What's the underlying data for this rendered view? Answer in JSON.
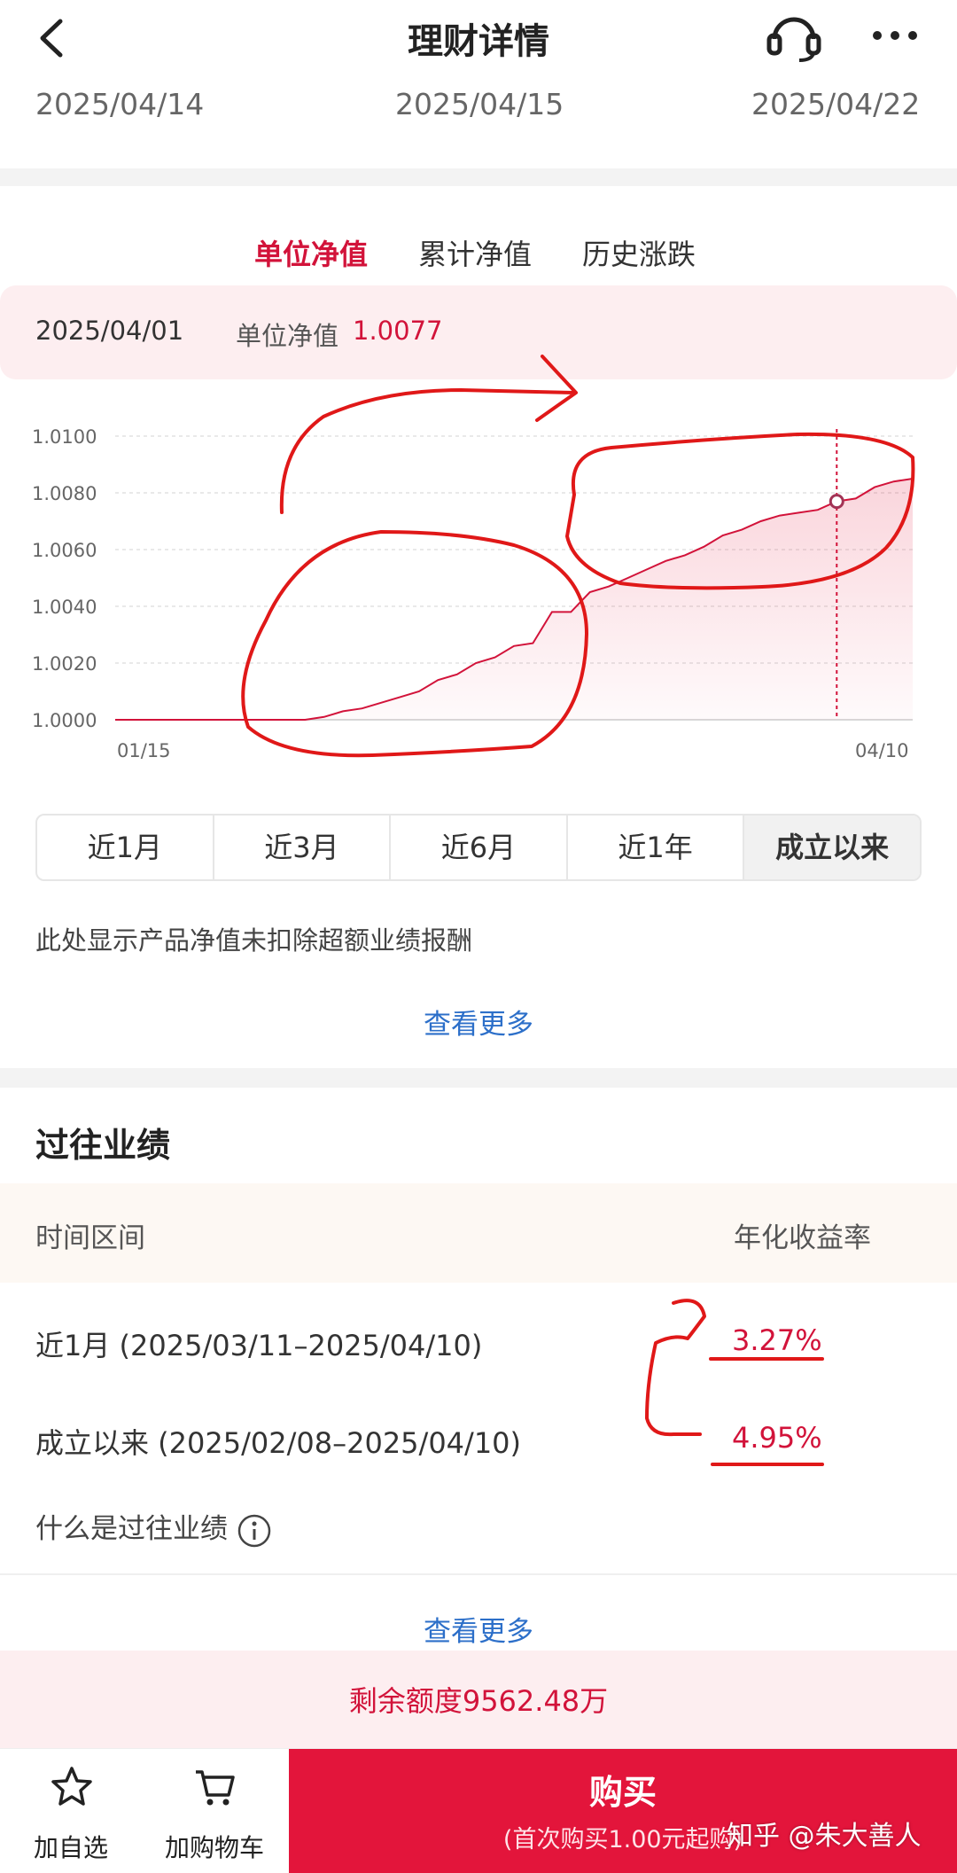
{
  "header": {
    "title": "理财详情",
    "back_icon": "chevron-left-icon",
    "service_icon": "headset-icon",
    "more_icon": "more-dots-icon"
  },
  "dates": [
    "2025/04/14",
    "2025/04/15",
    "2025/04/22"
  ],
  "tabs": [
    {
      "label": "单位净值",
      "active": true
    },
    {
      "label": "累计净值",
      "active": false
    },
    {
      "label": "历史涨跌",
      "active": false
    }
  ],
  "info_strip": {
    "date": "2025/04/01",
    "label": "单位净值",
    "value": "1.0077"
  },
  "chart_data": {
    "type": "area",
    "x_labels": [
      "01/15",
      "04/10"
    ],
    "y_ticks": [
      "1.0100",
      "1.0080",
      "1.0060",
      "1.0040",
      "1.0020",
      "1.0000"
    ],
    "ylim": [
      1.0,
      1.01
    ],
    "values": [
      1.0,
      1.0,
      1.0,
      1.0,
      1.0,
      1.0,
      1.0,
      1.0,
      1.0,
      1.0,
      1.0,
      1.0001,
      1.0003,
      1.0004,
      1.0006,
      1.0008,
      1.001,
      1.0014,
      1.0016,
      1.002,
      1.0022,
      1.0026,
      1.0027,
      1.0038,
      1.0038,
      1.0045,
      1.0047,
      1.005,
      1.0053,
      1.0056,
      1.0058,
      1.0061,
      1.0065,
      1.0067,
      1.007,
      1.0072,
      1.0073,
      1.0074,
      1.0077,
      1.0078,
      1.0082,
      1.0084,
      1.0085
    ],
    "highlight_index": 38,
    "grid": true,
    "color": "#d2133a"
  },
  "ranges": [
    {
      "label": "近1月",
      "active": false
    },
    {
      "label": "近3月",
      "active": false
    },
    {
      "label": "近6月",
      "active": false
    },
    {
      "label": "近1年",
      "active": false
    },
    {
      "label": "成立以来",
      "active": true
    }
  ],
  "note": "此处显示产品净值未扣除超额业绩报酬",
  "more_label": "查看更多",
  "performance": {
    "title": "过往业绩",
    "col_period": "时间区间",
    "col_rate": "年化收益率",
    "rows": [
      {
        "period": "近1月 (2025/03/11–2025/04/10)",
        "rate": "3.27%"
      },
      {
        "period": "成立以来 (2025/02/08–2025/04/10)",
        "rate": "4.95%"
      }
    ],
    "what_label": "什么是过往业绩",
    "info_icon": "info-circle-icon"
  },
  "remaining": "剩余额度9562.48万",
  "bottom_bar": {
    "watchlist_label": "加自选",
    "watchlist_icon": "star-icon",
    "cart_label": "加购物车",
    "cart_icon": "cart-icon",
    "buy_label": "购买",
    "buy_sub": "(首次购买1.00元起购)"
  },
  "watermark": "知乎 @朱大善人",
  "accent_color": "#d2133a"
}
